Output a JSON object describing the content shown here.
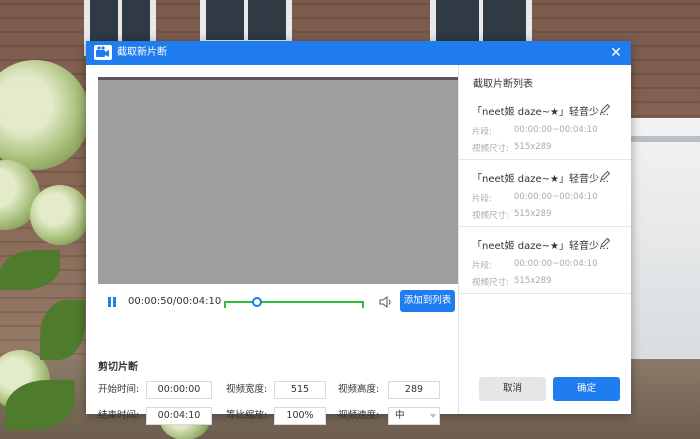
{
  "dialog": {
    "title": "截取新片断",
    "close_icon": "close-icon",
    "app_icon": "camera-icon"
  },
  "player": {
    "time": "00:00:50/00:04:10",
    "add_button": "添加到列表",
    "progress": 0.2
  },
  "cut": {
    "section_title": "剪切片断",
    "start_label": "开始时间:",
    "start_value": "00:00:00",
    "end_label": "结束时间:",
    "end_value": "00:04:10",
    "width_label": "视频宽度:",
    "width_value": "515",
    "height_label": "视频高度:",
    "height_value": "289",
    "scale_label": "等比缩放:",
    "scale_value": "100%",
    "speed_label": "视频速度:",
    "speed_value": "中"
  },
  "clips": {
    "title": "截取片断列表",
    "segment_label": "片段:",
    "size_label": "视频尺寸:",
    "items": [
      {
        "name": "「neet姬 daze~★」轻音少…",
        "segment": "00:00:00~00:04:10",
        "size": "515x289"
      },
      {
        "name": "「neet姬 daze~★」轻音少…",
        "segment": "00:00:00~00:04:10",
        "size": "515x289"
      },
      {
        "name": "「neet姬 daze~★」轻音少…",
        "segment": "00:00:00~00:04:10",
        "size": "515x289"
      }
    ]
  },
  "footer": {
    "cancel": "取消",
    "ok": "确定"
  },
  "colors": {
    "accent": "#1f7df0",
    "progress": "#2ebd3a"
  }
}
